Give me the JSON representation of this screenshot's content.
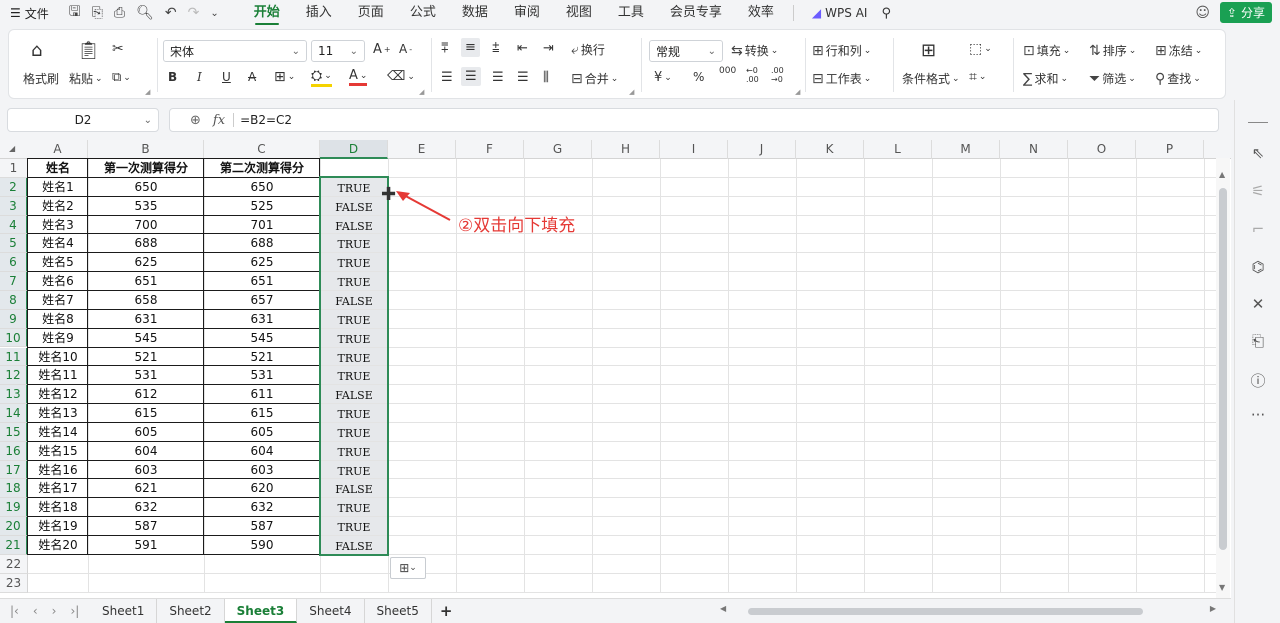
{
  "menubar": {
    "hamburger": "☰",
    "file": "文件",
    "tabs": [
      "开始",
      "插入",
      "页面",
      "公式",
      "数据",
      "审阅",
      "视图",
      "工具",
      "会员专享",
      "效率"
    ],
    "active_tab": "开始",
    "wps_ai": "WPS AI",
    "share": "分享"
  },
  "ribbon": {
    "format_painter": "格式刷",
    "paste": "粘贴",
    "font_name": "宋体",
    "font_size": "11",
    "bold": "B",
    "italic": "I",
    "underline": "U",
    "strike": "A",
    "wrap": "换行",
    "merge": "合并",
    "number_format": "常规",
    "convert": "转换",
    "row_col": "行和列",
    "worksheet": "工作表",
    "cond_format": "条件格式",
    "fill": "填充",
    "sort": "排序",
    "freeze": "冻结",
    "sum": "求和",
    "filter": "筛选",
    "find": "查找",
    "percent": "%",
    "thousands": "000",
    "inc_dec": "←0 .00",
    "dec_dec": ".00 →0"
  },
  "formula_bar": {
    "cell_ref": "D2",
    "fx": "fx",
    "formula": "=B2=C2"
  },
  "sheet": {
    "columns": [
      "A",
      "B",
      "C",
      "D",
      "E",
      "F",
      "G",
      "H",
      "I",
      "J",
      "K",
      "L",
      "M",
      "N",
      "O",
      "P"
    ],
    "selected_column": "D",
    "row_numbers": [
      "1",
      "2",
      "3",
      "4",
      "5",
      "6",
      "7",
      "8",
      "9",
      "10",
      "11",
      "12",
      "13",
      "14",
      "15",
      "16",
      "17",
      "18",
      "19",
      "20",
      "21",
      "22",
      "23"
    ],
    "headers": [
      "姓名",
      "第一次测算得分",
      "第二次测算得分",
      ""
    ],
    "rows": [
      [
        "姓名1",
        "650",
        "650",
        "TRUE"
      ],
      [
        "姓名2",
        "535",
        "525",
        "FALSE"
      ],
      [
        "姓名3",
        "700",
        "701",
        "FALSE"
      ],
      [
        "姓名4",
        "688",
        "688",
        "TRUE"
      ],
      [
        "姓名5",
        "625",
        "625",
        "TRUE"
      ],
      [
        "姓名6",
        "651",
        "651",
        "TRUE"
      ],
      [
        "姓名7",
        "658",
        "657",
        "FALSE"
      ],
      [
        "姓名8",
        "631",
        "631",
        "TRUE"
      ],
      [
        "姓名9",
        "545",
        "545",
        "TRUE"
      ],
      [
        "姓名10",
        "521",
        "521",
        "TRUE"
      ],
      [
        "姓名11",
        "531",
        "531",
        "TRUE"
      ],
      [
        "姓名12",
        "612",
        "611",
        "FALSE"
      ],
      [
        "姓名13",
        "615",
        "615",
        "TRUE"
      ],
      [
        "姓名14",
        "605",
        "605",
        "TRUE"
      ],
      [
        "姓名15",
        "604",
        "604",
        "TRUE"
      ],
      [
        "姓名16",
        "603",
        "603",
        "TRUE"
      ],
      [
        "姓名17",
        "621",
        "620",
        "FALSE"
      ],
      [
        "姓名18",
        "632",
        "632",
        "TRUE"
      ],
      [
        "姓名19",
        "587",
        "587",
        "TRUE"
      ],
      [
        "姓名20",
        "591",
        "590",
        "FALSE"
      ]
    ],
    "annotation": "②双击向下填充",
    "annotation_color": "#e53935"
  },
  "sheet_tabs": {
    "tabs": [
      "Sheet1",
      "Sheet2",
      "Sheet3",
      "Sheet4",
      "Sheet5"
    ],
    "active": "Sheet3",
    "add": "+"
  },
  "colors": {
    "accent": "#1a7f37",
    "selection": "#2e8b57"
  }
}
